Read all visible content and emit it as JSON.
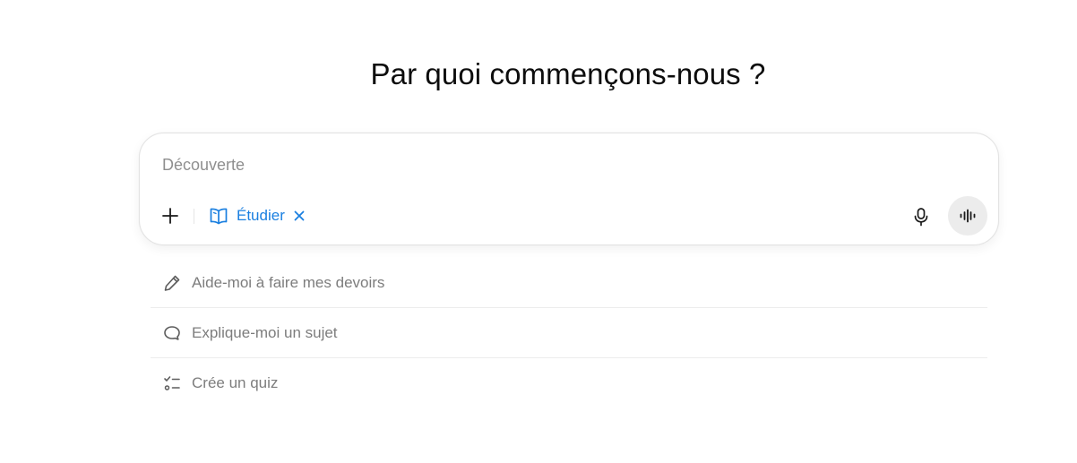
{
  "headline": "Par quoi commençons-nous ?",
  "composer": {
    "placeholder": "Découverte",
    "value": "",
    "add_icon": "plus-icon",
    "mode_chip": {
      "label": "Étudier",
      "icon": "book-open-icon",
      "remove_icon": "close-icon",
      "color": "#1a7fe0"
    },
    "mic_icon": "microphone-icon",
    "voice_icon": "voice-waveform-icon"
  },
  "suggestions": [
    {
      "label": "Aide-moi à faire mes devoirs",
      "icon": "pencil-icon"
    },
    {
      "label": "Explique-moi un sujet",
      "icon": "chat-bubble-icon"
    },
    {
      "label": "Crée un quiz",
      "icon": "checklist-icon"
    }
  ]
}
